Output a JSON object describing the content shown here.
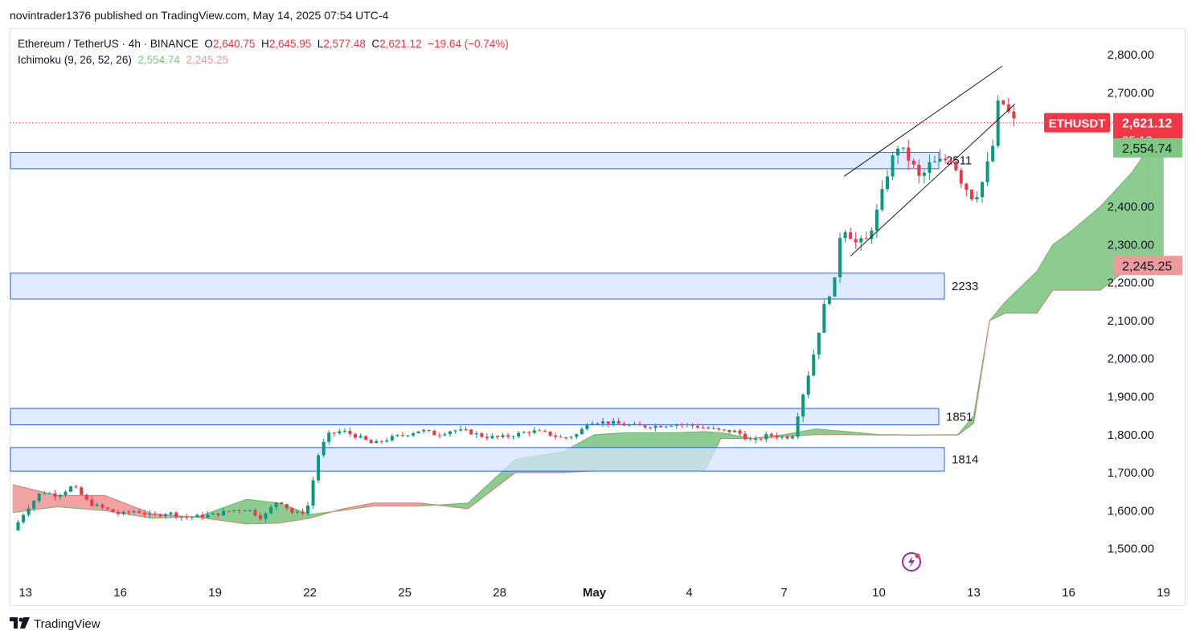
{
  "header": {
    "publisher": "novintrader1376",
    "published_text": "published on TradingView.com, May 14, 2025 07:54 UTC-4"
  },
  "legend": {
    "symbol": "Ethereum / TetherUS · 4h · BINANCE",
    "o_label": "O",
    "o_value": "2,640.75",
    "h_label": "H",
    "h_value": "2,645.95",
    "l_label": "L",
    "l_value": "2,577.48",
    "c_label": "C",
    "c_value": "2,621.12",
    "change": "−19.64 (−0.74%)",
    "ichimoku_label": "Ichimoku (9, 26, 52, 26)",
    "ichimoku_a": "2,554.74",
    "ichimoku_b": "2,245.25"
  },
  "price_badges": {
    "symbol": "ETHUSDT",
    "last": "2,621.12",
    "countdown": "05:12",
    "span_a": "2,554.74",
    "span_b": "2,245.25"
  },
  "footer": {
    "brand": "TradingView"
  },
  "colors": {
    "up": "#089981",
    "down": "#f23645",
    "cloud_bull": "#81c784",
    "cloud_bear": "#ef9a9a",
    "zone_fill": "#d6e4ff",
    "zone_border": "#2962ff"
  },
  "chart_data": {
    "type": "candlestick",
    "symbol": "ETHUSDT",
    "timeframe": "4h",
    "ylim": [
      1425,
      2870
    ],
    "y_ticks": [
      1500,
      1600,
      1700,
      1800,
      1900,
      2000,
      2100,
      2200,
      2300,
      2400,
      2500,
      2600,
      2700,
      2800
    ],
    "y_tick_labels": [
      "1,500.00",
      "1,600.00",
      "1,700.00",
      "1,800.00",
      "1,900.00",
      "2,000.00",
      "2,100.00",
      "2,200.00",
      "2,300.00",
      "2,400.00",
      "",
      "",
      "2,700.00",
      "2,800.00"
    ],
    "x_range_days": [
      12.5,
      19.7
    ],
    "x_ticks": [
      {
        "day": 13,
        "label": "13"
      },
      {
        "day": 16,
        "label": "16"
      },
      {
        "day": 19,
        "label": "19"
      },
      {
        "day": 22,
        "label": "22"
      },
      {
        "day": 25,
        "label": "25"
      },
      {
        "day": 28,
        "label": "28"
      },
      {
        "day": 31,
        "label": "May"
      },
      {
        "day": 34,
        "label": "4"
      },
      {
        "day": 37,
        "label": "7"
      },
      {
        "day": 40,
        "label": "10"
      },
      {
        "day": 43,
        "label": "13"
      },
      {
        "day": 46,
        "label": "16"
      },
      {
        "day": 49,
        "label": "19"
      }
    ],
    "x_domain": [
      12.5,
      49.7
    ],
    "zones": [
      {
        "label": "2511",
        "low": 2500,
        "high": 2543
      },
      {
        "label": "2233",
        "low": 2157,
        "high": 2225
      },
      {
        "label": "1851",
        "low": 1826,
        "high": 1869
      },
      {
        "label": "1814",
        "low": 1704,
        "high": 1766
      }
    ],
    "channel": [
      {
        "x1": 38.9,
        "y1": 2480,
        "x2": 43.9,
        "y2": 2770
      },
      {
        "x1": 39.1,
        "y1": 2270,
        "x2": 44.3,
        "y2": 2670
      }
    ],
    "last_price": 2621.12,
    "key_points": [
      [
        12.6,
        1548
      ],
      [
        13.0,
        1600
      ],
      [
        13.5,
        1650
      ],
      [
        14.0,
        1640
      ],
      [
        14.5,
        1665
      ],
      [
        15.0,
        1620
      ],
      [
        15.5,
        1605
      ],
      [
        16.0,
        1590
      ],
      [
        16.5,
        1600
      ],
      [
        17.0,
        1585
      ],
      [
        17.5,
        1595
      ],
      [
        18.0,
        1582
      ],
      [
        18.5,
        1585
      ],
      [
        19.0,
        1590
      ],
      [
        19.5,
        1600
      ],
      [
        20.0,
        1605
      ],
      [
        20.5,
        1580
      ],
      [
        21.0,
        1630
      ],
      [
        21.5,
        1590
      ],
      [
        21.9,
        1600
      ],
      [
        22.3,
        1760
      ],
      [
        22.6,
        1800
      ],
      [
        23.0,
        1810
      ],
      [
        23.5,
        1795
      ],
      [
        24.0,
        1775
      ],
      [
        24.5,
        1790
      ],
      [
        25.0,
        1800
      ],
      [
        25.5,
        1812
      ],
      [
        26.0,
        1800
      ],
      [
        26.5,
        1812
      ],
      [
        27.0,
        1808
      ],
      [
        27.5,
        1795
      ],
      [
        28.0,
        1792
      ],
      [
        28.5,
        1800
      ],
      [
        29.0,
        1810
      ],
      [
        29.5,
        1803
      ],
      [
        30.0,
        1790
      ],
      [
        30.5,
        1802
      ],
      [
        30.8,
        1835
      ],
      [
        31.5,
        1832
      ],
      [
        32.0,
        1825
      ],
      [
        32.5,
        1822
      ],
      [
        33.0,
        1823
      ],
      [
        33.5,
        1828
      ],
      [
        34.0,
        1825
      ],
      [
        34.5,
        1818
      ],
      [
        35.0,
        1810
      ],
      [
        35.5,
        1808
      ],
      [
        36.0,
        1780
      ],
      [
        36.5,
        1800
      ],
      [
        37.0,
        1792
      ],
      [
        37.3,
        1800
      ],
      [
        37.5,
        1880
      ],
      [
        37.9,
        2000
      ],
      [
        38.3,
        2150
      ],
      [
        38.6,
        2200
      ],
      [
        38.8,
        2350
      ],
      [
        39.0,
        2340
      ],
      [
        39.3,
        2300
      ],
      [
        39.6,
        2310
      ],
      [
        40.0,
        2400
      ],
      [
        40.3,
        2500
      ],
      [
        40.6,
        2560
      ],
      [
        41.0,
        2520
      ],
      [
        41.3,
        2470
      ],
      [
        41.6,
        2510
      ],
      [
        42.0,
        2520
      ],
      [
        42.3,
        2530
      ],
      [
        42.6,
        2470
      ],
      [
        43.0,
        2420
      ],
      [
        43.3,
        2470
      ],
      [
        43.6,
        2560
      ],
      [
        43.8,
        2690
      ],
      [
        44.0,
        2660
      ],
      [
        44.3,
        2620
      ]
    ],
    "ichimoku": {
      "span_a": [
        [
          12.6,
          1595
        ],
        [
          14.0,
          1610
        ],
        [
          15.5,
          1600
        ],
        [
          17.0,
          1580
        ],
        [
          18.5,
          1585
        ],
        [
          20.0,
          1630
        ],
        [
          21.0,
          1620
        ],
        [
          22.0,
          1590
        ],
        [
          23.0,
          1600
        ],
        [
          24.0,
          1612
        ],
        [
          25.5,
          1612
        ],
        [
          27.0,
          1620
        ],
        [
          28.5,
          1735
        ],
        [
          30.0,
          1755
        ],
        [
          31.0,
          1800
        ],
        [
          32.0,
          1805
        ],
        [
          33.5,
          1805
        ],
        [
          34.5,
          1808
        ],
        [
          35.0,
          1805
        ],
        [
          36.0,
          1790
        ],
        [
          37.0,
          1800
        ],
        [
          38.0,
          1815
        ],
        [
          39.0,
          1808
        ],
        [
          40.0,
          1800
        ],
        [
          40.5,
          1800
        ],
        [
          41.0,
          1799
        ],
        [
          42.5,
          1800
        ],
        [
          43.0,
          1850
        ],
        [
          43.5,
          2100
        ],
        [
          44.0,
          2150
        ],
        [
          45.0,
          2230
        ],
        [
          45.5,
          2300
        ],
        [
          46.0,
          2330
        ],
        [
          47.0,
          2400
        ],
        [
          48.0,
          2490
        ],
        [
          48.5,
          2550
        ],
        [
          49.0,
          2554.74
        ]
      ],
      "span_b": [
        [
          12.6,
          1668
        ],
        [
          14.0,
          1640
        ],
        [
          15.5,
          1640
        ],
        [
          17.0,
          1592
        ],
        [
          18.5,
          1582
        ],
        [
          20.0,
          1565
        ],
        [
          21.0,
          1567
        ],
        [
          22.0,
          1580
        ],
        [
          23.0,
          1604
        ],
        [
          24.0,
          1620
        ],
        [
          25.5,
          1620
        ],
        [
          27.0,
          1605
        ],
        [
          28.5,
          1700
        ],
        [
          30.0,
          1700
        ],
        [
          31.0,
          1705
        ],
        [
          32.0,
          1705
        ],
        [
          33.5,
          1705
        ],
        [
          34.5,
          1705
        ],
        [
          35.0,
          1790
        ],
        [
          36.0,
          1790
        ],
        [
          37.0,
          1795
        ],
        [
          38.0,
          1800
        ],
        [
          39.0,
          1800
        ],
        [
          40.0,
          1799
        ],
        [
          40.5,
          1799
        ],
        [
          41.0,
          1799
        ],
        [
          42.5,
          1799
        ],
        [
          43.0,
          1830
        ],
        [
          43.5,
          2100
        ],
        [
          44.0,
          2120
        ],
        [
          45.0,
          2120
        ],
        [
          45.5,
          2180
        ],
        [
          46.0,
          2180
        ],
        [
          47.0,
          2180
        ],
        [
          48.0,
          2245
        ],
        [
          48.5,
          2245
        ],
        [
          49.0,
          2245.25
        ]
      ]
    }
  }
}
